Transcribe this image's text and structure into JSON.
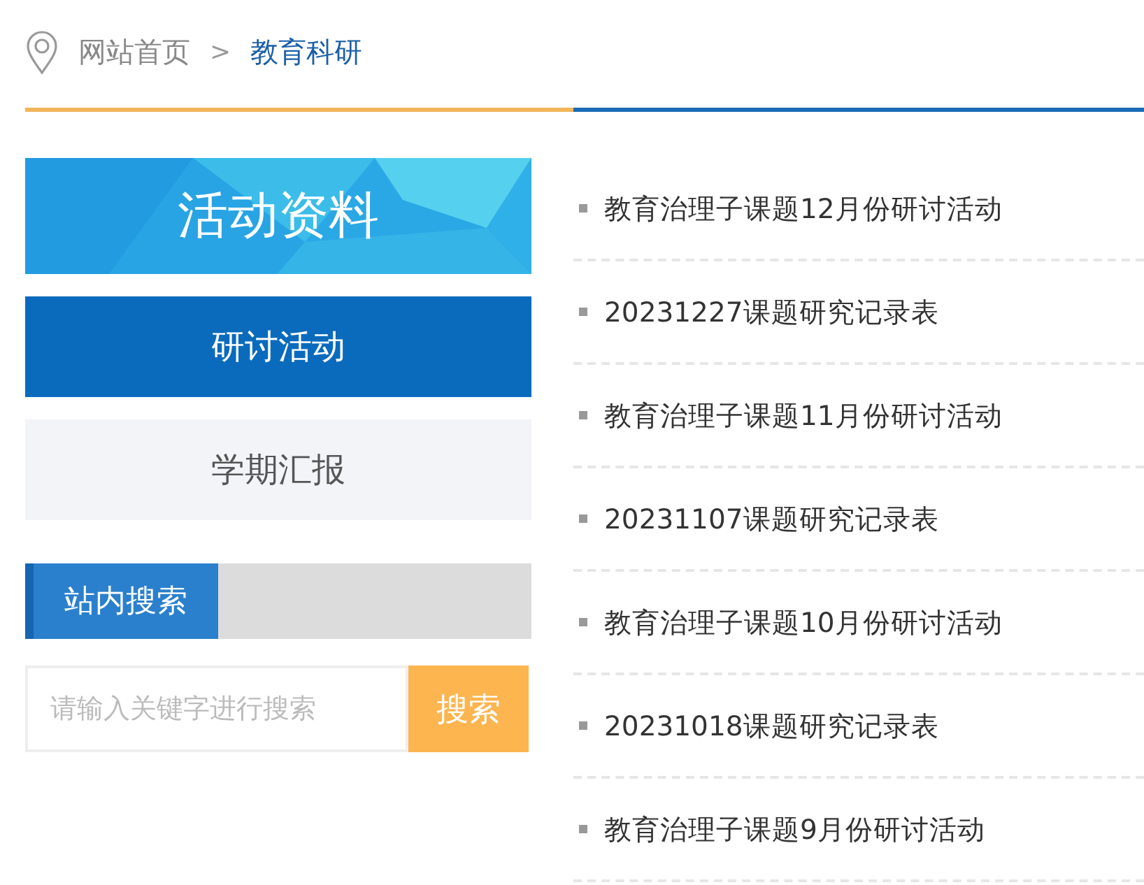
{
  "breadcrumb": {
    "items": [
      {
        "label": "网站首页",
        "current": false
      },
      {
        "label": "教育科研",
        "current": true
      }
    ],
    "separator": ">"
  },
  "sidebar": {
    "title": "活动资料",
    "items": [
      {
        "label": "研讨活动",
        "selected": true
      },
      {
        "label": "学期汇报",
        "selected": false
      }
    ],
    "search": {
      "heading": "站内搜索",
      "placeholder": "请输入关键字进行搜索",
      "button": "搜索"
    }
  },
  "articles": [
    {
      "title": "教育治理子课题12月份研讨活动"
    },
    {
      "title": "20231227课题研究记录表"
    },
    {
      "title": "教育治理子课题11月份研讨活动"
    },
    {
      "title": "20231107课题研究记录表"
    },
    {
      "title": "教育治理子课题10月份研讨活动"
    },
    {
      "title": "20231018课题研究记录表"
    },
    {
      "title": "教育治理子课题9月份研讨活动"
    }
  ]
}
